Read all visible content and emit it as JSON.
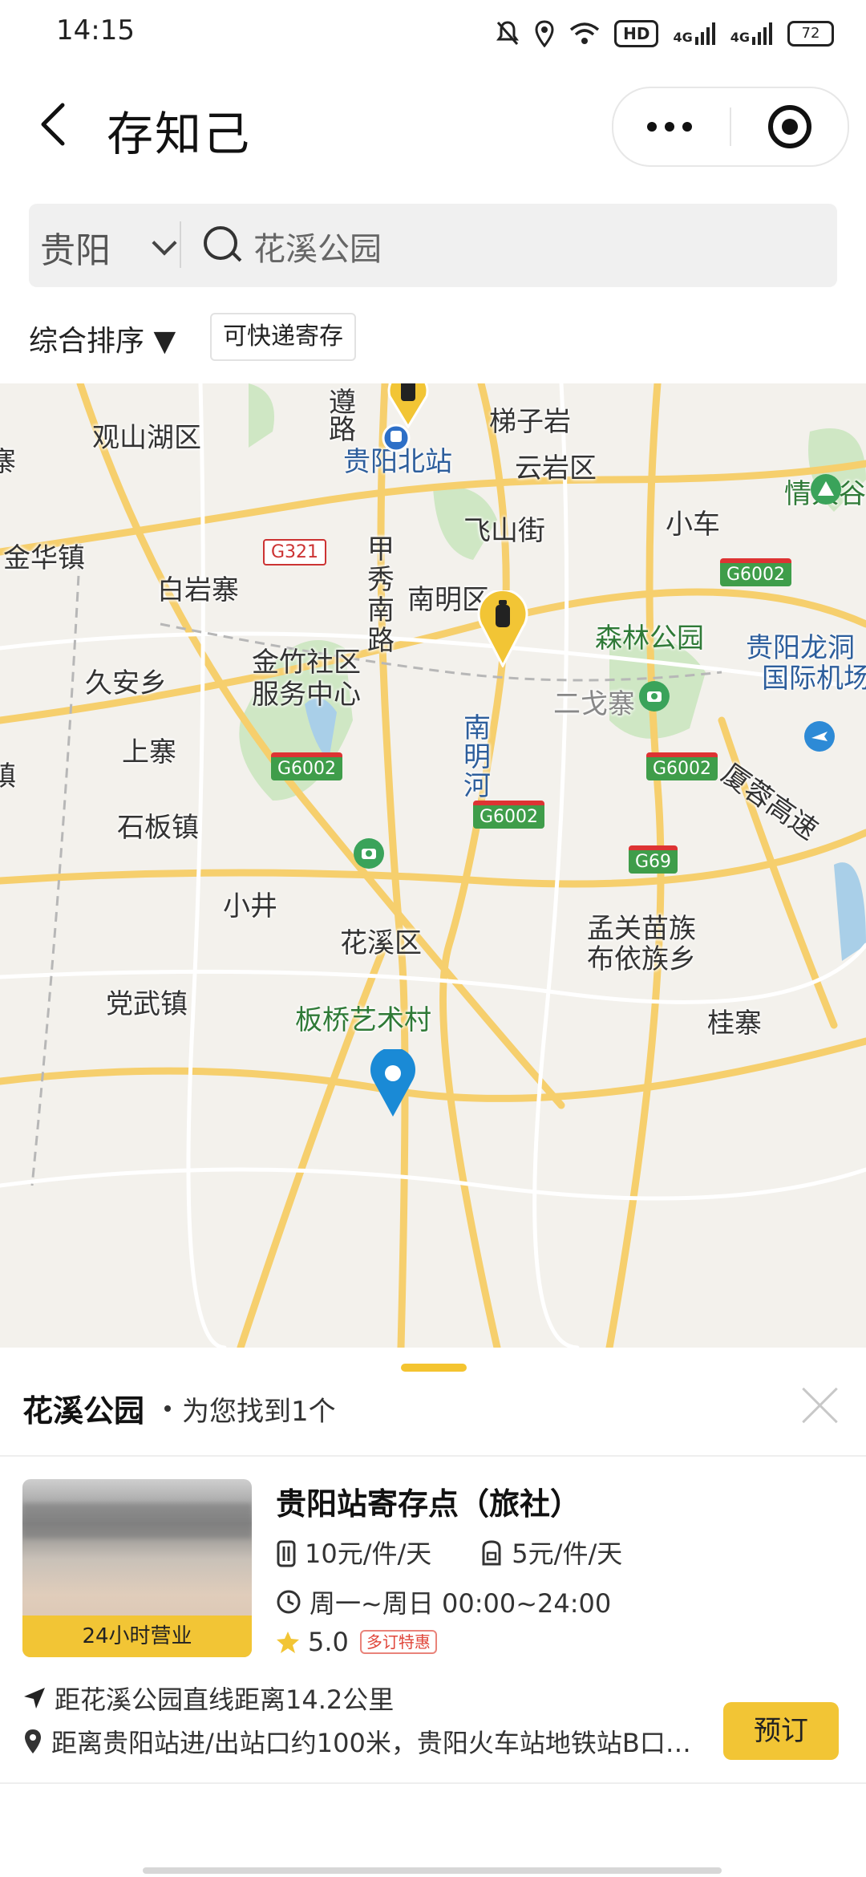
{
  "status": {
    "time": "14:15",
    "hd": "HD",
    "net1": "4G",
    "net2": "4G",
    "battery": "72"
  },
  "header": {
    "title": "存知己",
    "icons": [
      "back-arrow-icon",
      "more-dots-icon",
      "target-icon"
    ]
  },
  "search": {
    "city": "贵阳",
    "query": "花溪公园"
  },
  "filters": {
    "sort_label": "综合排序 ▼",
    "tag": "可快递寄存"
  },
  "map": {
    "places": [
      "观山湖区",
      "梯子岩",
      "贵阳北站",
      "云岩区",
      "小车",
      "情人谷",
      "金华镇",
      "白岩寨",
      "甲秀南路",
      "飞山街",
      "南明区",
      "森林公园",
      "贵阳龙洞",
      "国际机场",
      "久安乡",
      "金竹社区",
      "服务中心",
      "二戈寨",
      "上寨",
      "南明河",
      "石板镇",
      "小井",
      "花溪区",
      "孟关苗族",
      "布依族乡",
      "党武镇",
      "板桥艺术村",
      "桂寨",
      "厦蓉高速",
      "遵",
      "路",
      "寨",
      "镇"
    ],
    "road_shields": [
      "G321",
      "G6002",
      "G6002",
      "G6002",
      "G6002",
      "G69"
    ]
  },
  "result": {
    "place": "花溪公园",
    "found": "为您找到1个",
    "store_name": "贵阳站寄存点（旅社）",
    "open_badge": "24小时营业",
    "price_large": "10元/件/天",
    "price_small": "5元/件/天",
    "hours": "周一~周日 00:00~24:00",
    "rating": "5.0",
    "promo": "多订特惠",
    "distance": "距花溪公园直线距离14.2公里",
    "address": "距离贵阳站进/出站口约100米，贵阳火车站地铁站B口…",
    "book_label": "预订"
  },
  "colors": {
    "accent": "#f2c535",
    "map_pin": "#1a8ad6",
    "map_bg": "#f3f1ec"
  }
}
